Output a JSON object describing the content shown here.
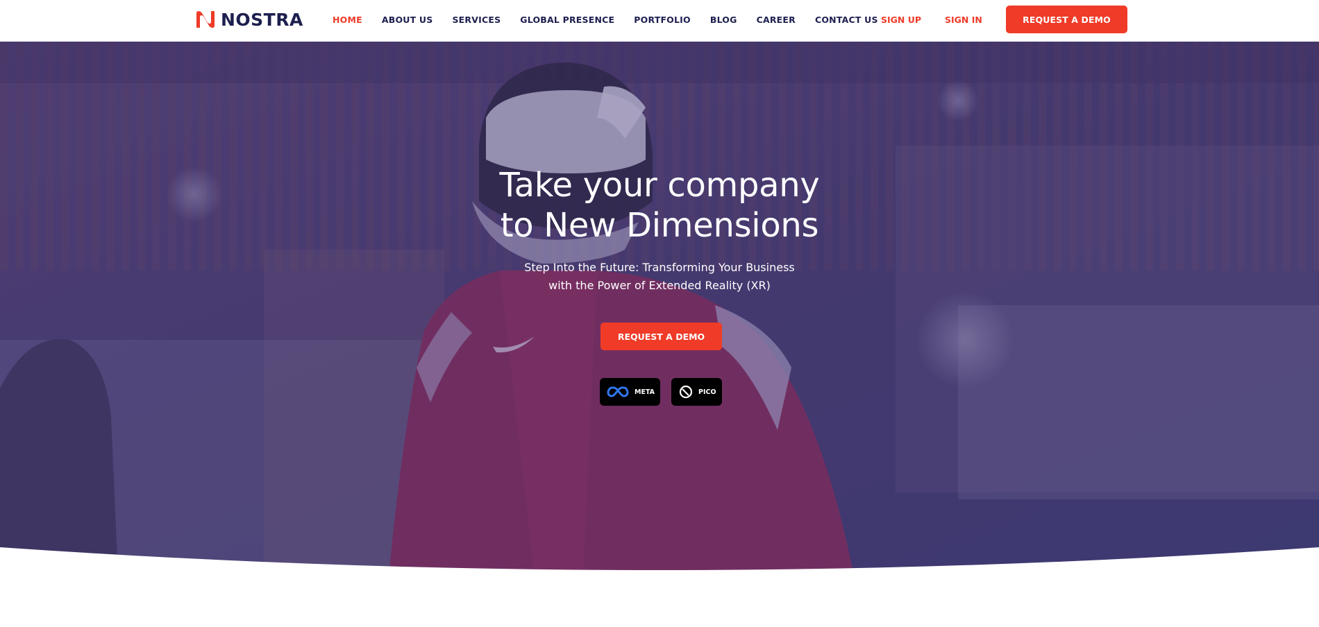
{
  "brand": {
    "name": "NOSTRA",
    "accent": "#ef3b28",
    "navy": "#1d1f4f"
  },
  "nav": {
    "items": [
      {
        "label": "HOME",
        "active": true
      },
      {
        "label": "ABOUT US"
      },
      {
        "label": "SERVICES"
      },
      {
        "label": "GLOBAL PRESENCE"
      },
      {
        "label": "PORTFOLIO"
      },
      {
        "label": "BLOG"
      },
      {
        "label": "CAREER"
      },
      {
        "label": "CONTACT US"
      }
    ],
    "sign_up": "SIGN UP",
    "sign_in": "SIGN IN",
    "cta": "REQUEST A DEMO"
  },
  "hero": {
    "title_line1": "Take your company",
    "title_line2": "to New Dimensions",
    "subtitle_line1": "Step Into the Future: Transforming Your Business",
    "subtitle_line2": "with the Power of Extended Reality (XR)",
    "cta": "REQUEST A DEMO",
    "badges": [
      {
        "label": "META",
        "icon": "meta-infinity-icon"
      },
      {
        "label": "PICO",
        "icon": "pico-logo-icon"
      }
    ]
  }
}
